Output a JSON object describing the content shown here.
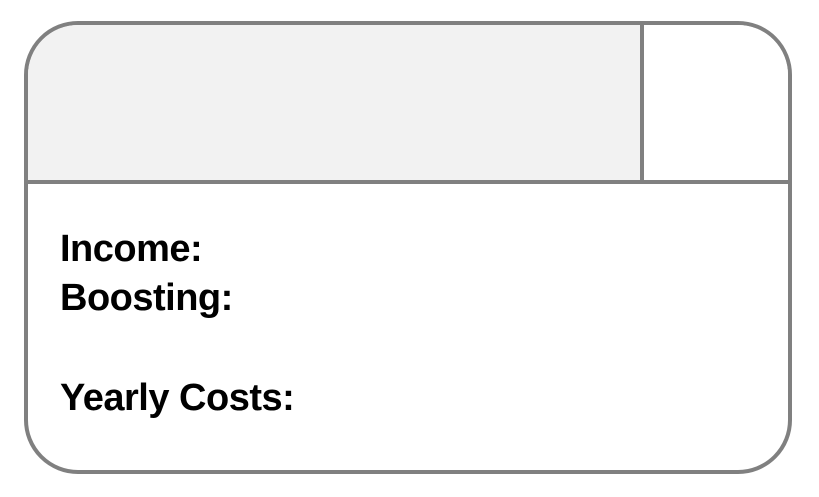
{
  "card": {
    "colors": {
      "border": "#808080",
      "header_fill": "#f2f2f2",
      "body_fill": "#ffffff",
      "text": "#000000"
    },
    "stats": {
      "income_label": "Income:",
      "boosting_label": "Boosting:",
      "yearly_costs_label": "Yearly Costs:"
    }
  }
}
